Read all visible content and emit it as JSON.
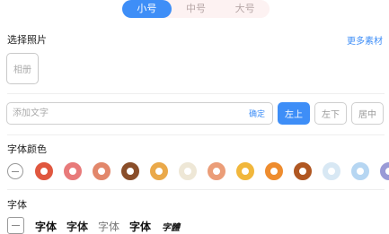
{
  "size_tabs": [
    "小号",
    "中号",
    "大号"
  ],
  "photo": {
    "title": "选择照片",
    "more_link": "更多素材",
    "button_label": "相册"
  },
  "text_input": {
    "placeholder": "添加文字",
    "value": "",
    "confirm": "确定"
  },
  "positions": [
    "左上",
    "左下",
    "居中"
  ],
  "font_color": {
    "title": "字体颜色",
    "swatches": [
      "#e0573f",
      "#e87a7a",
      "#e2876b",
      "#8a4e2a",
      "#eaa94a",
      "#eee7d6",
      "#eb9d78",
      "#f1b73c",
      "#ee8c2e",
      "#b05722",
      "#d8e8f4",
      "#b6d6f2",
      "#9a9ad6"
    ]
  },
  "font": {
    "title": "字体",
    "samples": [
      "字体",
      "字体",
      "字体",
      "字体",
      "字體"
    ]
  },
  "colors": {
    "accent": "#3e8ef7",
    "tab_bg": "#fdf2f2"
  }
}
